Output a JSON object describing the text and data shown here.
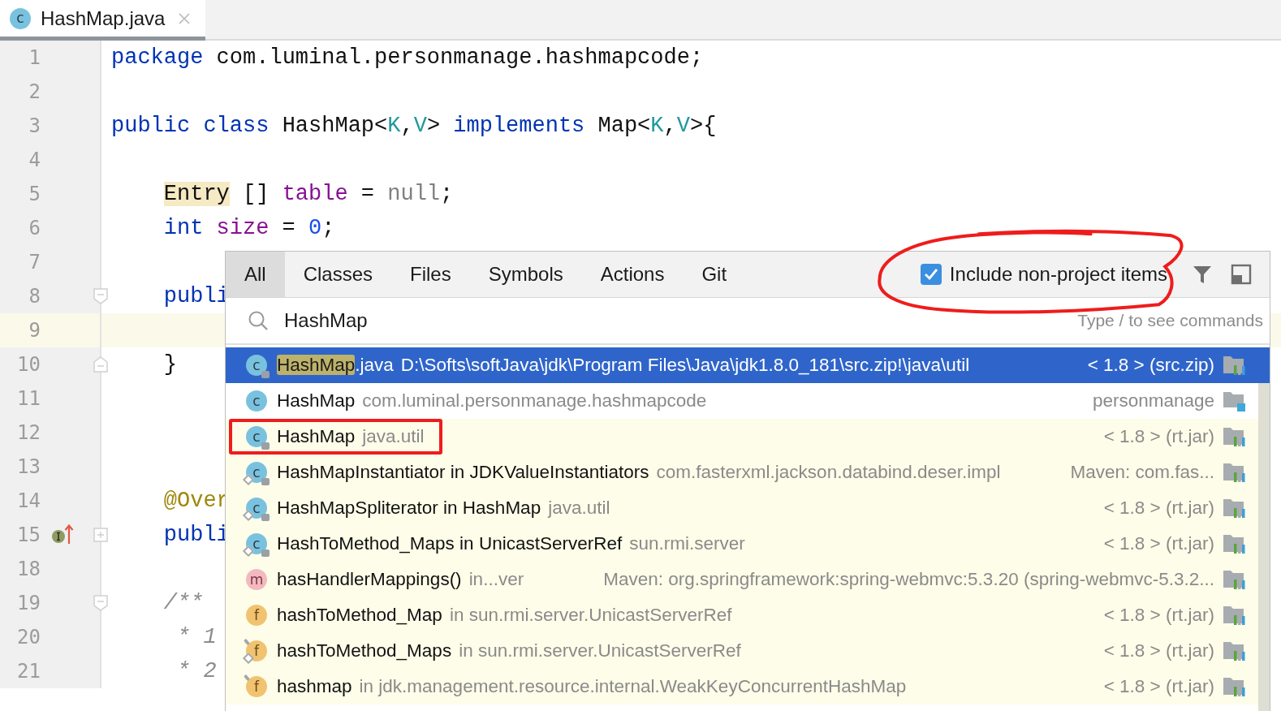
{
  "editor_tab": {
    "title": "HashMap.java",
    "icon_letter": "c",
    "selected": true
  },
  "code_lines": [
    {
      "number": "1",
      "current": false,
      "tokens": [
        {
          "kind": "keyword",
          "text": "package"
        },
        {
          "kind": "plain",
          "text": " com.luminal.personmanage.hashmapcode;"
        }
      ]
    },
    {
      "number": "2",
      "current": false
    },
    {
      "number": "3",
      "current": false,
      "tokens": [
        {
          "kind": "keyword",
          "text": "public"
        },
        {
          "kind": "keyword",
          "text": " class"
        },
        {
          "kind": "plain",
          "text": " HashMap<"
        },
        {
          "kind": "typeparam",
          "text": "K"
        },
        {
          "kind": "plain",
          "text": ","
        },
        {
          "kind": "typeparam",
          "text": "V"
        },
        {
          "kind": "plain",
          "text": "> "
        },
        {
          "kind": "keyword",
          "text": "implements"
        },
        {
          "kind": "plain",
          "text": " Map<"
        },
        {
          "kind": "typeparam",
          "text": "K"
        },
        {
          "kind": "plain",
          "text": ","
        },
        {
          "kind": "typeparam",
          "text": "V"
        },
        {
          "kind": "plain",
          "text": ">{"
        }
      ]
    },
    {
      "number": "4",
      "current": false
    },
    {
      "number": "5",
      "current": false,
      "indent": {
        "kind": "member"
      },
      "tokens": [
        {
          "kind": "usage",
          "text": "Entry"
        },
        {
          "kind": "plain",
          "text": " [] "
        },
        {
          "kind": "field",
          "text": "table"
        },
        {
          "kind": "plain",
          "text": " = "
        },
        {
          "kind": "null",
          "text": "null"
        },
        {
          "kind": "plain",
          "text": ";"
        }
      ]
    },
    {
      "number": "6",
      "current": false,
      "indent": {
        "kind": "member"
      },
      "tokens": [
        {
          "kind": "keyword",
          "text": "int"
        },
        {
          "kind": "field",
          "text": " size"
        },
        {
          "kind": "plain",
          "text": " = "
        },
        {
          "kind": "number",
          "text": "0"
        },
        {
          "kind": "plain",
          "text": ";"
        }
      ]
    },
    {
      "number": "7",
      "current": false
    },
    {
      "number": "8",
      "current": false,
      "fold": {
        "kind": "start"
      },
      "indent": {
        "kind": "member"
      },
      "tokens": [
        {
          "kind": "keyword",
          "text": "publi"
        }
      ]
    },
    {
      "number": "9",
      "current": true
    },
    {
      "number": "10",
      "current": false,
      "fold": {
        "kind": "end"
      },
      "indent": {
        "kind": "member"
      },
      "tokens": [
        {
          "kind": "plain",
          "text": "}"
        }
      ]
    },
    {
      "number": "11",
      "current": false
    },
    {
      "number": "12",
      "current": false
    },
    {
      "number": "13",
      "current": false
    },
    {
      "number": "14",
      "current": false,
      "indent": {
        "kind": "member"
      },
      "tokens": [
        {
          "kind": "annotation",
          "text": "@Over"
        }
      ]
    },
    {
      "number": "15",
      "current": false,
      "fold": {
        "kind": "collapsed"
      },
      "marker": {
        "kind": "implements"
      },
      "indent": {
        "kind": "member"
      },
      "tokens": [
        {
          "kind": "keyword",
          "text": "publi"
        }
      ]
    },
    {
      "number": "18",
      "current": false
    },
    {
      "number": "19",
      "current": false,
      "fold": {
        "kind": "start"
      },
      "indent": {
        "kind": "member"
      },
      "tokens": [
        {
          "kind": "comment",
          "text": "/**"
        }
      ]
    },
    {
      "number": "20",
      "current": false,
      "indent": {
        "kind": "doc"
      },
      "tokens": [
        {
          "kind": "comment",
          "text": "* 1"
        }
      ]
    },
    {
      "number": "21",
      "current": false,
      "indent": {
        "kind": "doc"
      },
      "tokens": [
        {
          "kind": "comment",
          "text": "* 2"
        }
      ]
    }
  ],
  "search_popup": {
    "tabs": [
      {
        "label": "All",
        "selected": true
      },
      {
        "label": "Classes",
        "selected": false
      },
      {
        "label": "Files",
        "selected": false
      },
      {
        "label": "Symbols",
        "selected": false
      },
      {
        "label": "Actions",
        "selected": false
      },
      {
        "label": "Git",
        "selected": false
      }
    ],
    "include_option": {
      "label": "Include non-project items",
      "checked": true,
      "annotated": true
    },
    "search": {
      "value": "HashMap",
      "hint": "Type / to see commands"
    },
    "results": [
      {
        "icon": {
          "kind": "class",
          "letter": "c",
          "locked": true,
          "nested": false,
          "static": false
        },
        "name": [
          {
            "text": "HashMap",
            "matched": true
          },
          {
            "text": ".java",
            "matched": false
          }
        ],
        "detail": "D:\\Softs\\softJava\\jdk\\Program Files\\Java\\jdk1.8.0_181\\src.zip!\\java\\util",
        "location": "< 1.8 > (src.zip)",
        "library": {
          "kind": "jdk"
        },
        "selected": true,
        "project": false,
        "annotated": false
      },
      {
        "icon": {
          "kind": "class",
          "letter": "c",
          "locked": false,
          "nested": false,
          "static": false
        },
        "name": [
          {
            "text": "HashMap",
            "matched": false
          }
        ],
        "detail": "com.luminal.personmanage.hashmapcode",
        "location": "personmanage",
        "library": {
          "kind": "module"
        },
        "selected": false,
        "project": true,
        "annotated": false
      },
      {
        "icon": {
          "kind": "class",
          "letter": "c",
          "locked": true,
          "nested": false,
          "static": false
        },
        "name": [
          {
            "text": "HashMap",
            "matched": false
          }
        ],
        "detail": "java.util",
        "location": "< 1.8 > (rt.jar)",
        "library": {
          "kind": "jdk"
        },
        "selected": false,
        "project": false,
        "annotated": true
      },
      {
        "icon": {
          "kind": "class",
          "letter": "c",
          "locked": true,
          "nested": true,
          "static": false
        },
        "name": [
          {
            "text": "HashMapInstantiator in JDKValueInstantiators",
            "matched": false
          }
        ],
        "detail": "com.fasterxml.jackson.databind.deser.impl",
        "location": "Maven: com.fas...",
        "library": {
          "kind": "jdk"
        },
        "selected": false,
        "project": false,
        "annotated": false
      },
      {
        "icon": {
          "kind": "class",
          "letter": "c",
          "locked": true,
          "nested": true,
          "static": false
        },
        "name": [
          {
            "text": "HashMapSpliterator in HashMap",
            "matched": false
          }
        ],
        "detail": "java.util",
        "location": "< 1.8 > (rt.jar)",
        "library": {
          "kind": "jdk"
        },
        "selected": false,
        "project": false,
        "annotated": false
      },
      {
        "icon": {
          "kind": "class",
          "letter": "c",
          "locked": true,
          "nested": true,
          "static": false
        },
        "name": [
          {
            "text": "HashToMethod_Maps in UnicastServerRef",
            "matched": false
          }
        ],
        "detail": "sun.rmi.server",
        "location": "< 1.8 > (rt.jar)",
        "library": {
          "kind": "jdk"
        },
        "selected": false,
        "project": false,
        "annotated": false
      },
      {
        "icon": {
          "kind": "method",
          "letter": "m",
          "locked": false,
          "nested": false,
          "static": false
        },
        "name": [
          {
            "text": "hasHandlerMappings()",
            "matched": false
          }
        ],
        "detail": "in...ver",
        "location": "Maven: org.springframework:spring-webmvc:5.3.20 (spring-webmvc-5.3.2...",
        "library": {
          "kind": "jdk"
        },
        "selected": false,
        "project": false,
        "annotated": false
      },
      {
        "icon": {
          "kind": "field",
          "letter": "f",
          "locked": false,
          "nested": false,
          "static": false
        },
        "name": [
          {
            "text": "hashToMethod_Map",
            "matched": false
          }
        ],
        "detail": "in sun.rmi.server.UnicastServerRef",
        "location": "< 1.8 > (rt.jar)",
        "library": {
          "kind": "jdk"
        },
        "selected": false,
        "project": false,
        "annotated": false
      },
      {
        "icon": {
          "kind": "field",
          "letter": "f",
          "locked": false,
          "nested": true,
          "static": true
        },
        "name": [
          {
            "text": "hashToMethod_Maps",
            "matched": false
          }
        ],
        "detail": "in sun.rmi.server.UnicastServerRef",
        "location": "< 1.8 > (rt.jar)",
        "library": {
          "kind": "jdk"
        },
        "selected": false,
        "project": false,
        "annotated": false
      },
      {
        "icon": {
          "kind": "field",
          "letter": "f",
          "locked": false,
          "nested": false,
          "static": true
        },
        "name": [
          {
            "text": "hashmap",
            "matched": false
          }
        ],
        "detail": "in jdk.management.resource.internal.WeakKeyConcurrentHashMap",
        "location": "< 1.8 > (rt.jar)",
        "library": {
          "kind": "jdk"
        },
        "selected": false,
        "project": false,
        "annotated": false
      }
    ]
  }
}
